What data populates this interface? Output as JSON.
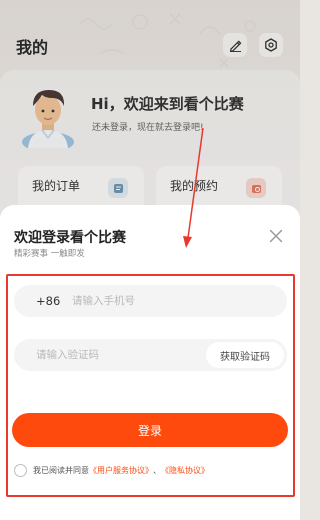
{
  "header": {
    "title": "我的",
    "edit_icon": "edit-icon",
    "settings_icon": "settings-icon"
  },
  "profile": {
    "greeting": "Hi，欢迎来到看个比赛",
    "subtext": "还未登录，现在就去登录吧!"
  },
  "quick_cards": [
    {
      "title": "我的订单",
      "icon": "order-icon"
    },
    {
      "title": "我的预约",
      "icon": "calendar-icon"
    }
  ],
  "login_sheet": {
    "title": "欢迎登录看个比赛",
    "subtitle": "精彩赛事 一触即发",
    "close_icon": "close-icon",
    "phone_prefix": "+86",
    "phone_placeholder": "请输入手机号",
    "phone_value": "",
    "code_placeholder": "请输入验证码",
    "code_value": "",
    "get_code_label": "获取验证码",
    "login_label": "登录",
    "agreement_prefix": "我已阅读并同意",
    "user_agreement": "《用户服务协议》",
    "separator": "、",
    "privacy_policy": "《隐私协议》",
    "agreement_checked": false
  },
  "colors": {
    "accent": "#ff4a0e",
    "annotation": "#e8392c",
    "field_bg": "#f4f4f5"
  }
}
